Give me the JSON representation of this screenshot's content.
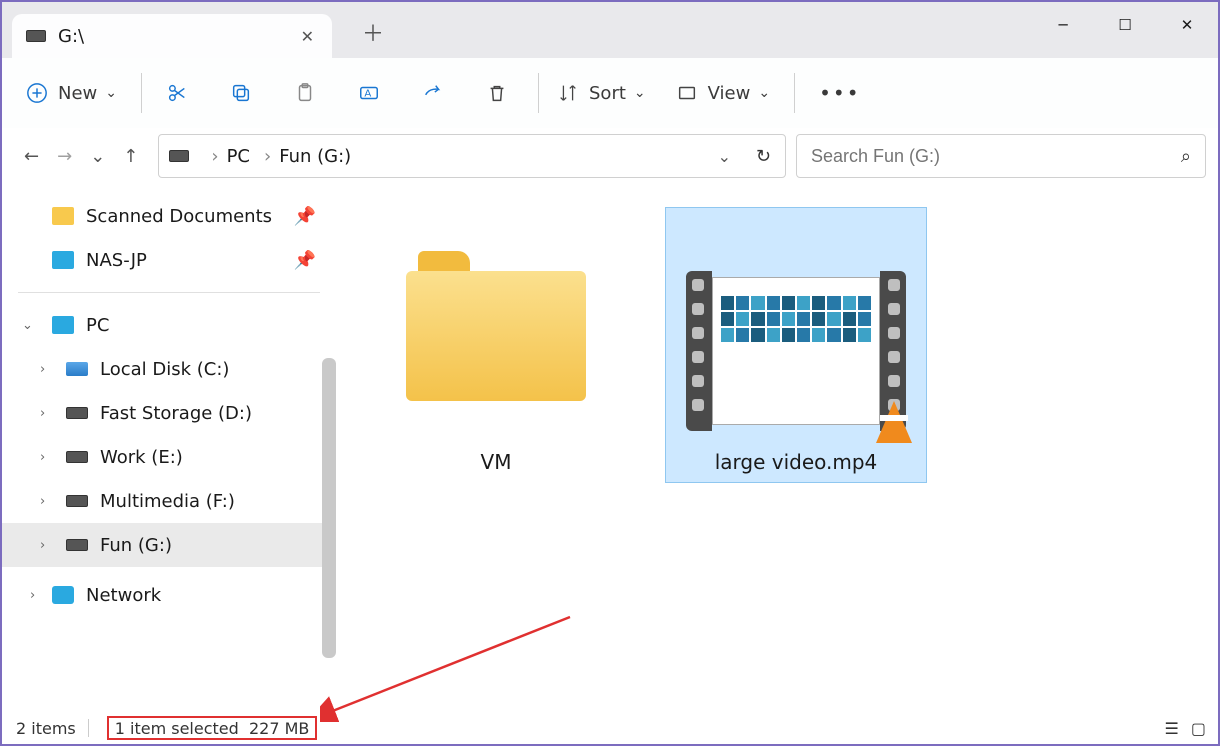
{
  "window": {
    "tab_title": "G:\\",
    "minimize_glyph": "─",
    "maximize_glyph": "☐",
    "close_glyph": "✕"
  },
  "toolbar": {
    "new_label": "New",
    "sort_label": "Sort",
    "view_label": "View"
  },
  "breadcrumb": {
    "root": "PC",
    "current": "Fun (G:)"
  },
  "search": {
    "placeholder": "Search Fun (G:)"
  },
  "sidebar": {
    "quick": [
      {
        "label": "Scanned Documents",
        "icon": "folder"
      },
      {
        "label": "NAS-JP",
        "icon": "monitor"
      }
    ],
    "pc_label": "PC",
    "drives": [
      {
        "label": "Local Disk (C:)",
        "icon": "cdisk"
      },
      {
        "label": "Fast Storage (D:)",
        "icon": "disk"
      },
      {
        "label": "Work (E:)",
        "icon": "disk"
      },
      {
        "label": "Multimedia (F:)",
        "icon": "disk"
      },
      {
        "label": "Fun (G:)",
        "icon": "disk",
        "selected": true
      }
    ],
    "network_label": "Network"
  },
  "files": {
    "folder": {
      "label": "VM"
    },
    "video": {
      "label": "large video.mp4"
    }
  },
  "status": {
    "count": "2 items",
    "selection": "1 item selected",
    "size": "227 MB"
  }
}
